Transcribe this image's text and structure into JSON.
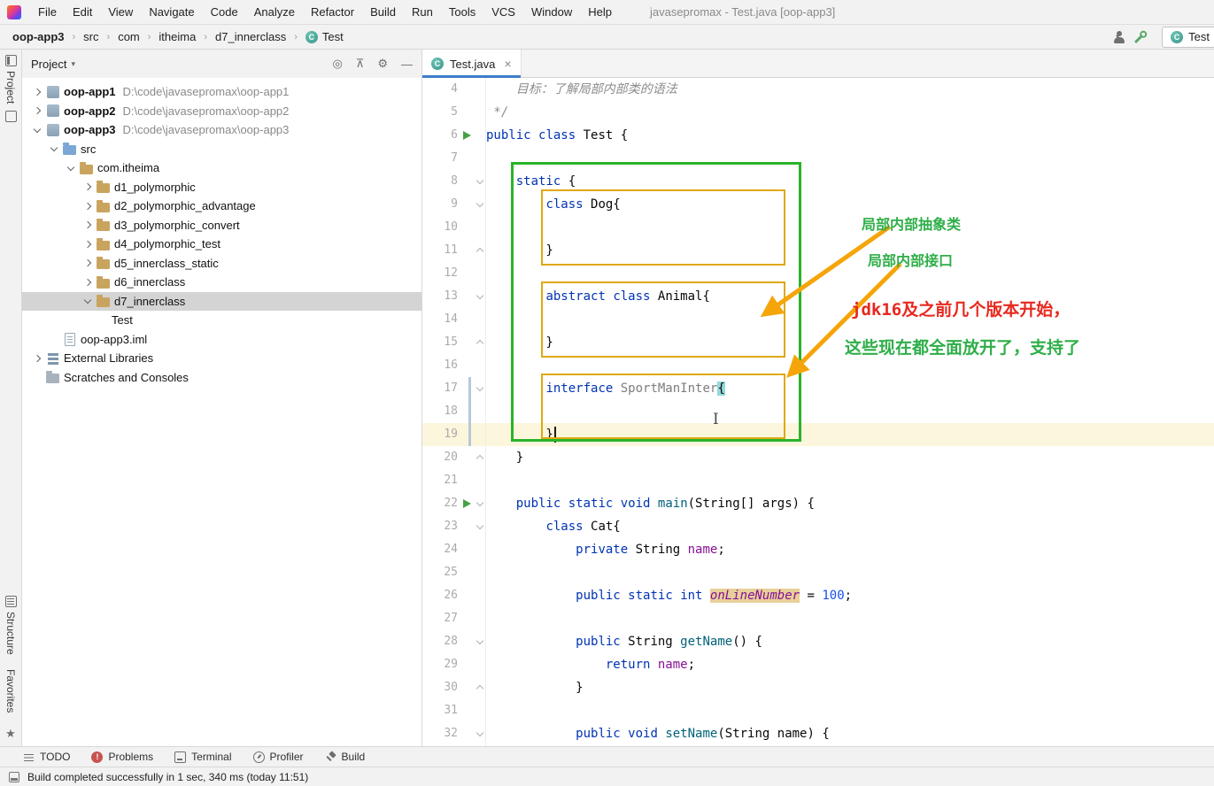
{
  "menu_bar": {
    "items": [
      "File",
      "Edit",
      "View",
      "Navigate",
      "Code",
      "Analyze",
      "Refactor",
      "Build",
      "Run",
      "Tools",
      "VCS",
      "Window",
      "Help"
    ],
    "window_title": "javasepromax - Test.java [oop-app3]"
  },
  "breadcrumbs": {
    "items": [
      {
        "label": "oop-app3",
        "bold": true
      },
      {
        "label": "src"
      },
      {
        "label": "com"
      },
      {
        "label": "itheima"
      },
      {
        "label": "d7_innerclass"
      },
      {
        "label": "Test",
        "icon": "class"
      }
    ]
  },
  "toolbar": {
    "run_config": "Test"
  },
  "stripe": {
    "project_label": "Project",
    "structure_label": "Structure",
    "favorites_label": "Favorites"
  },
  "project_panel": {
    "title": "Project",
    "header_icons": [
      {
        "id": "locate-icon",
        "glyph": "◎"
      },
      {
        "id": "collapse-all-icon",
        "glyph": "⊼"
      },
      {
        "id": "settings-icon",
        "glyph": "⚙"
      },
      {
        "id": "hide-panel-icon",
        "glyph": "—"
      }
    ],
    "tree": [
      {
        "label": "oop-app1",
        "path": "D:\\code\\javasepromax\\oop-app1",
        "level": 1,
        "chevron": "right",
        "icon": "module",
        "bold": true
      },
      {
        "label": "oop-app2",
        "path": "D:\\code\\javasepromax\\oop-app2",
        "level": 1,
        "chevron": "right",
        "icon": "module",
        "bold": true
      },
      {
        "label": "oop-app3",
        "path": "D:\\code\\javasepromax\\oop-app3",
        "level": 1,
        "chevron": "down",
        "icon": "module",
        "bold": true
      },
      {
        "label": "src",
        "level": 2,
        "chevron": "down",
        "icon": "folder-src"
      },
      {
        "label": "com.itheima",
        "level": 3,
        "chevron": "down",
        "icon": "package"
      },
      {
        "label": "d1_polymorphic",
        "level": 4,
        "chevron": "right",
        "icon": "package"
      },
      {
        "label": "d2_polymorphic_advantage",
        "level": 4,
        "chevron": "right",
        "icon": "package"
      },
      {
        "label": "d3_polymorphic_convert",
        "level": 4,
        "chevron": "right",
        "icon": "package"
      },
      {
        "label": "d4_polymorphic_test",
        "level": 4,
        "chevron": "right",
        "icon": "package"
      },
      {
        "label": "d5_innerclass_static",
        "level": 4,
        "chevron": "right",
        "icon": "package"
      },
      {
        "label": "d6_innerclass",
        "level": 4,
        "chevron": "right",
        "icon": "package"
      },
      {
        "label": "d7_innerclass",
        "level": 4,
        "chevron": "down",
        "icon": "package",
        "selected": true
      },
      {
        "label": "Test",
        "level": 5,
        "icon": "class"
      },
      {
        "label": "oop-app3.iml",
        "level": 2,
        "icon": "file"
      },
      {
        "label": "External Libraries",
        "level": 1,
        "chevron": "right",
        "icon": "library"
      },
      {
        "label": "Scratches and Consoles",
        "level": 1,
        "icon": "scratch"
      }
    ]
  },
  "editor": {
    "tab_label": "Test.java",
    "caret_line": 19,
    "run_lines": [
      6,
      22
    ],
    "lines": [
      {
        "n": 4,
        "tokens": [
          {
            "t": "    ",
            "c": "p"
          },
          {
            "t": "目标：了解局部内部类的语法",
            "c": "cm"
          }
        ]
      },
      {
        "n": 5,
        "tokens": [
          {
            "t": " */",
            "c": "cm"
          }
        ]
      },
      {
        "n": 6,
        "tokens": [
          {
            "t": "public",
            "c": "k"
          },
          {
            "t": " ",
            "c": "p"
          },
          {
            "t": "class",
            "c": "k"
          },
          {
            "t": " Test {",
            "c": "p"
          }
        ]
      },
      {
        "n": 7,
        "tokens": []
      },
      {
        "n": 8,
        "fold": "down",
        "tokens": [
          {
            "t": "    ",
            "c": "p"
          },
          {
            "t": "static",
            "c": "k"
          },
          {
            "t": " {",
            "c": "p"
          }
        ]
      },
      {
        "n": 9,
        "fold": "down",
        "tokens": [
          {
            "t": "        ",
            "c": "p"
          },
          {
            "t": "class",
            "c": "k"
          },
          {
            "t": " Dog{",
            "c": "p"
          }
        ]
      },
      {
        "n": 10,
        "tokens": []
      },
      {
        "n": 11,
        "fold": "up",
        "tokens": [
          {
            "t": "        }",
            "c": "p"
          }
        ]
      },
      {
        "n": 12,
        "tokens": []
      },
      {
        "n": 13,
        "fold": "down",
        "tokens": [
          {
            "t": "        ",
            "c": "p"
          },
          {
            "t": "abstract",
            "c": "k"
          },
          {
            "t": " ",
            "c": "p"
          },
          {
            "t": "class",
            "c": "k"
          },
          {
            "t": " Animal{",
            "c": "p"
          }
        ]
      },
      {
        "n": 14,
        "tokens": []
      },
      {
        "n": 15,
        "fold": "up",
        "tokens": [
          {
            "t": "        }",
            "c": "p"
          }
        ]
      },
      {
        "n": 16,
        "tokens": []
      },
      {
        "n": 17,
        "fold": "down",
        "tokens": [
          {
            "t": "        ",
            "c": "p"
          },
          {
            "t": "interface",
            "c": "k"
          },
          {
            "t": " ",
            "c": "p"
          },
          {
            "t": "SportManInter",
            "c": "gray"
          },
          {
            "t": "{",
            "c": "brh"
          }
        ]
      },
      {
        "n": 18,
        "tokens": []
      },
      {
        "n": 19,
        "tokens": [
          {
            "t": "        }",
            "c": "p"
          }
        ]
      },
      {
        "n": 20,
        "fold": "up",
        "tokens": [
          {
            "t": "    }",
            "c": "p"
          }
        ]
      },
      {
        "n": 21,
        "tokens": []
      },
      {
        "n": 22,
        "fold": "down",
        "tokens": [
          {
            "t": "    ",
            "c": "p"
          },
          {
            "t": "public",
            "c": "k"
          },
          {
            "t": " ",
            "c": "p"
          },
          {
            "t": "static",
            "c": "k"
          },
          {
            "t": " ",
            "c": "p"
          },
          {
            "t": "void",
            "c": "k"
          },
          {
            "t": " ",
            "c": "p"
          },
          {
            "t": "main",
            "c": "fn"
          },
          {
            "t": "(String[] args) {",
            "c": "p"
          }
        ]
      },
      {
        "n": 23,
        "fold": "down",
        "tokens": [
          {
            "t": "        ",
            "c": "p"
          },
          {
            "t": "class",
            "c": "k"
          },
          {
            "t": " Cat{",
            "c": "p"
          }
        ]
      },
      {
        "n": 24,
        "tokens": [
          {
            "t": "            ",
            "c": "p"
          },
          {
            "t": "private",
            "c": "k"
          },
          {
            "t": " String ",
            "c": "p"
          },
          {
            "t": "name",
            "c": "fld"
          },
          {
            "t": ";",
            "c": "p"
          }
        ]
      },
      {
        "n": 25,
        "tokens": []
      },
      {
        "n": 26,
        "tokens": [
          {
            "t": "            ",
            "c": "p"
          },
          {
            "t": "public",
            "c": "k"
          },
          {
            "t": " ",
            "c": "p"
          },
          {
            "t": "static",
            "c": "k"
          },
          {
            "t": " ",
            "c": "p"
          },
          {
            "t": "int",
            "c": "k"
          },
          {
            "t": " ",
            "c": "p"
          },
          {
            "t": "onLineNumber",
            "c": "fldhl"
          },
          {
            "t": " = ",
            "c": "p"
          },
          {
            "t": "100",
            "c": "num"
          },
          {
            "t": ";",
            "c": "p"
          }
        ]
      },
      {
        "n": 27,
        "tokens": []
      },
      {
        "n": 28,
        "fold": "down",
        "tokens": [
          {
            "t": "            ",
            "c": "p"
          },
          {
            "t": "public",
            "c": "k"
          },
          {
            "t": " String ",
            "c": "p"
          },
          {
            "t": "getName",
            "c": "fn"
          },
          {
            "t": "() {",
            "c": "p"
          }
        ]
      },
      {
        "n": 29,
        "tokens": [
          {
            "t": "                ",
            "c": "p"
          },
          {
            "t": "return",
            "c": "k"
          },
          {
            "t": " ",
            "c": "p"
          },
          {
            "t": "name",
            "c": "fld"
          },
          {
            "t": ";",
            "c": "p"
          }
        ]
      },
      {
        "n": 30,
        "fold": "up",
        "tokens": [
          {
            "t": "            }",
            "c": "p"
          }
        ]
      },
      {
        "n": 31,
        "tokens": []
      },
      {
        "n": 32,
        "fold": "down",
        "tokens": [
          {
            "t": "            ",
            "c": "p"
          },
          {
            "t": "public",
            "c": "k"
          },
          {
            "t": " ",
            "c": "p"
          },
          {
            "t": "void",
            "c": "k"
          },
          {
            "t": " ",
            "c": "p"
          },
          {
            "t": "setName",
            "c": "fn"
          },
          {
            "t": "(String name) {",
            "c": "p"
          }
        ]
      }
    ]
  },
  "overlay": {
    "label_abstract": "局部内部抽象类",
    "label_interface": "局部内部接口",
    "note_jdk": "jdk16及之前几个版本开始，",
    "note_support": "这些现在都全面放开了，支持了"
  },
  "bottom_bar": {
    "items": [
      {
        "label": "TODO",
        "icon": "icon-todo"
      },
      {
        "label": "Problems",
        "icon": "icon-problems"
      },
      {
        "label": "Terminal",
        "icon": "icon-terminal"
      },
      {
        "label": "Profiler",
        "icon": "icon-profiler"
      },
      {
        "label": "Build",
        "icon": "icon-build"
      }
    ]
  },
  "status_bar": {
    "message": "Build completed successfully in 1 sec, 340 ms (today 11:51)"
  },
  "colors": {
    "annotation_green": "#29b329",
    "annotation_yellow": "#dfa812",
    "arrow_orange": "#f5a50a",
    "note_green": "#2fae49",
    "note_red": "#e8281e",
    "caret_line": "#fcf6dd",
    "selection_gray": "#d4d4d4",
    "tab_underline": "#3d7dc8"
  }
}
